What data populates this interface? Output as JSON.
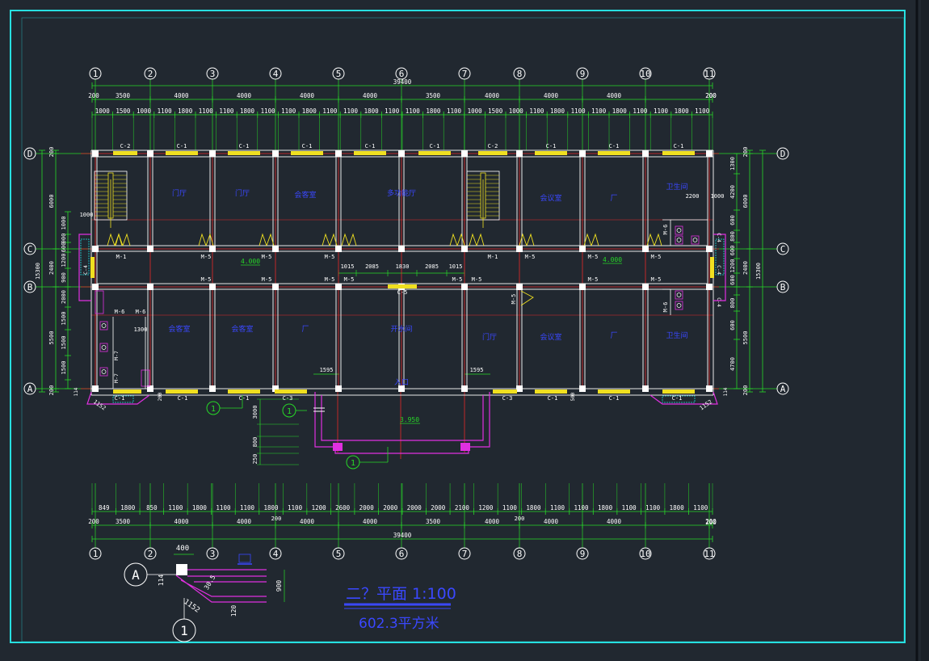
{
  "colors": {
    "background": "#212830",
    "frame": "#27e0e0",
    "dim": "#27d827",
    "wall": "#e8e8e8",
    "axis_red": "#e82828",
    "window_yellow": "#f0e020",
    "room_blue": "#3a48ff",
    "magenta": "#e030e0",
    "cyan": "#20d8d8",
    "white": "#ffffff"
  },
  "axes": {
    "vertical": [
      "1",
      "2",
      "3",
      "4",
      "5",
      "6",
      "7",
      "8",
      "9",
      "10",
      "11"
    ],
    "horizontal": [
      "A",
      "B",
      "C",
      "D"
    ]
  },
  "dims_top": {
    "total": "39400",
    "edge_left": "200",
    "edge_right": "200",
    "bays": [
      "3500",
      "4000",
      "4000",
      "4000",
      "4000",
      "3500",
      "4000",
      "4000",
      "4000"
    ],
    "details": [
      "1000",
      "1500",
      "1000",
      "1100",
      "1800",
      "1100",
      "1100",
      "1800",
      "1100",
      "1100",
      "1800",
      "1100",
      "1100",
      "1800",
      "1100",
      "1100",
      "1800",
      "1100",
      "1000",
      "1500",
      "1000",
      "1100",
      "1800",
      "1100",
      "1100",
      "1800",
      "1100",
      "1100",
      "1800",
      "1100"
    ]
  },
  "dims_bottom": {
    "total": "39400",
    "edge_left": "200",
    "edge_right": "200",
    "mid_a": "200",
    "mid_b": "200",
    "bays": [
      "3500",
      "4000",
      "4000",
      "4000",
      "4000",
      "3500",
      "4000",
      "4000",
      "4000"
    ],
    "details": [
      "849",
      "1800",
      "850",
      "1100",
      "1800",
      "1100",
      "1100",
      "1800",
      "1100",
      "1200",
      "2600",
      "2000",
      "2000",
      "2000",
      "2000",
      "2100",
      "1200",
      "1100",
      "1800",
      "1100",
      "1100",
      "1800",
      "1100",
      "1100",
      "1800",
      "1100"
    ]
  },
  "dims_left": {
    "total": "15300",
    "bays": [
      "5500",
      "2400",
      "6000"
    ],
    "edge_top": "200",
    "edge_bottom": "200",
    "details": [
      "1500",
      "1500",
      "1500",
      "2000",
      "900",
      "1200",
      "600",
      "900",
      "1000"
    ]
  },
  "dims_right": {
    "total": "15300",
    "bays": [
      "5500",
      "2400",
      "6000"
    ],
    "edge_top": "200",
    "edge_bottom": "200",
    "details": [
      "4700",
      "600",
      "800",
      "600",
      "1200",
      "600",
      "800",
      "600",
      "4200",
      "1300"
    ]
  },
  "windows": {
    "north": [
      "C-2",
      "C-1",
      "C-1",
      "C-1",
      "C-1",
      "C-1",
      "C-2",
      "C-1",
      "C-1",
      "C-1"
    ],
    "south": [
      "C-1",
      "C-1",
      "C-1",
      "C-3",
      "C-3",
      "C-1",
      "C-1",
      "C-1",
      "C-1"
    ],
    "corridor": "C-5",
    "side": [
      "C-4",
      "C-4",
      "C-4",
      "C-4"
    ]
  },
  "doors": {
    "upper": [
      "M-1",
      "M-5",
      "M-5",
      "M-5",
      "M-1",
      "M-5",
      "M-5",
      "M-5"
    ],
    "lower": [
      "M-5",
      "M-5",
      "M-5",
      "M-5",
      "M-5",
      "M-5",
      "M-5",
      "M-5",
      "M-5"
    ],
    "wc": [
      "M-6",
      "M-6",
      "M-6",
      "M-6",
      "M-5"
    ]
  },
  "labels": {
    "floor_elev": "4.000",
    "floor_elev2": "4.000",
    "balcony_elev": "3.950",
    "corridor_dims": [
      "1015",
      "2085",
      "1830",
      "2085",
      "1015"
    ],
    "dim_1595a": "1595",
    "dim_1595b": "1595",
    "dim_1300": "1300",
    "dim_1000": "1000",
    "dim_2200": "2200",
    "dim_1000b": "1000",
    "dim_1152a": "1152",
    "dim_1152b": "1152",
    "dim_114a": "114",
    "dim_114b": "114",
    "dim_500": "500",
    "dim_3000": "3000",
    "dim_800": "800",
    "dim_250": "250"
  },
  "rooms": {
    "upper": [
      "门厅",
      "门厅",
      "会客室",
      "多功能厅",
      "会议室",
      "厂",
      "卫生间"
    ],
    "lower": [
      "会客室",
      "会客室",
      "厂",
      "开水间",
      "门厅",
      "会议室",
      "厂",
      "卫生间"
    ],
    "entrance": "入口"
  },
  "detail": {
    "axis_a": "A",
    "axis_1": "1",
    "dim_400": "400",
    "dim_114": "114",
    "dim_305": "30.5",
    "dim_1152": "1152",
    "dim_120": "120",
    "dim_900": "900"
  },
  "callouts": [
    "1",
    "1",
    "1"
  ],
  "title": {
    "main": "二？平面 1:100",
    "area": "602.3平方米"
  }
}
